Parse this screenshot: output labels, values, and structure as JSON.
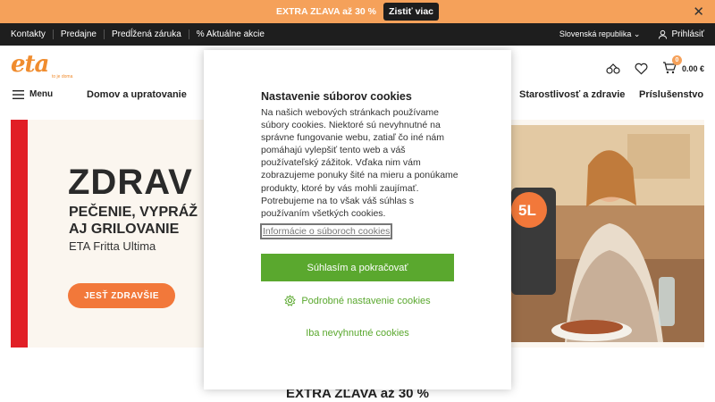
{
  "promo": {
    "text": "EXTRA ZĽAVA až 30 %",
    "cta": "Zistiť viac"
  },
  "utility": {
    "links": [
      "Kontakty",
      "Predajne",
      "Predĺžená záruka",
      "% Aktuálne akcie"
    ],
    "country": "Slovenská republika",
    "login": "Prihlásiť"
  },
  "header": {
    "logo": "eta",
    "tagline": "to je doma",
    "cart_count": "0",
    "cart_total": "0.00 €"
  },
  "catnav": {
    "menu_label": "Menu",
    "items": [
      "Domov a upratovanie",
      "Starostlivosť a zdravie",
      "Príslušenstvo"
    ]
  },
  "hero": {
    "headline": "ZDRAV",
    "subheadline": "PEČENIE, VYPRÁŽ\nAJ GRILOVANIE",
    "product": "ETA Fritta Ultima",
    "button": "JESŤ ZDRAVŠIE",
    "badge": "5L"
  },
  "bottom_promo": "EXTRA ZĽAVA až 30 %",
  "cookie_modal": {
    "title": "Nastavenie súborov cookies",
    "body": "Na našich webových stránkach používame súbory cookies. Niektoré sú nevyhnutné na správne fungovanie webu, zatiaľ čo iné nám pomáhajú vylepšiť tento web a váš používateľský zážitok. Vďaka nim vám zobrazujeme ponuky šité na mieru a ponúkame produkty, ktoré by vás mohli zaujímať. Potrebujeme na to však váš súhlas s používaním všetkých cookies.",
    "info_link": "Informácie o súboroch cookies",
    "accept": "Súhlasím a pokračovať",
    "detailed": "Podrobné nastavenie cookies",
    "necessary": "Iba nevyhnutné cookies"
  },
  "colors": {
    "promo_bg": "#f5a15a",
    "utility_bg": "#1e1e1e",
    "brand_orange": "#f08c2e",
    "hero_red": "#e11f26",
    "hero_button": "#f2783a",
    "accept_green": "#5aa82e"
  }
}
